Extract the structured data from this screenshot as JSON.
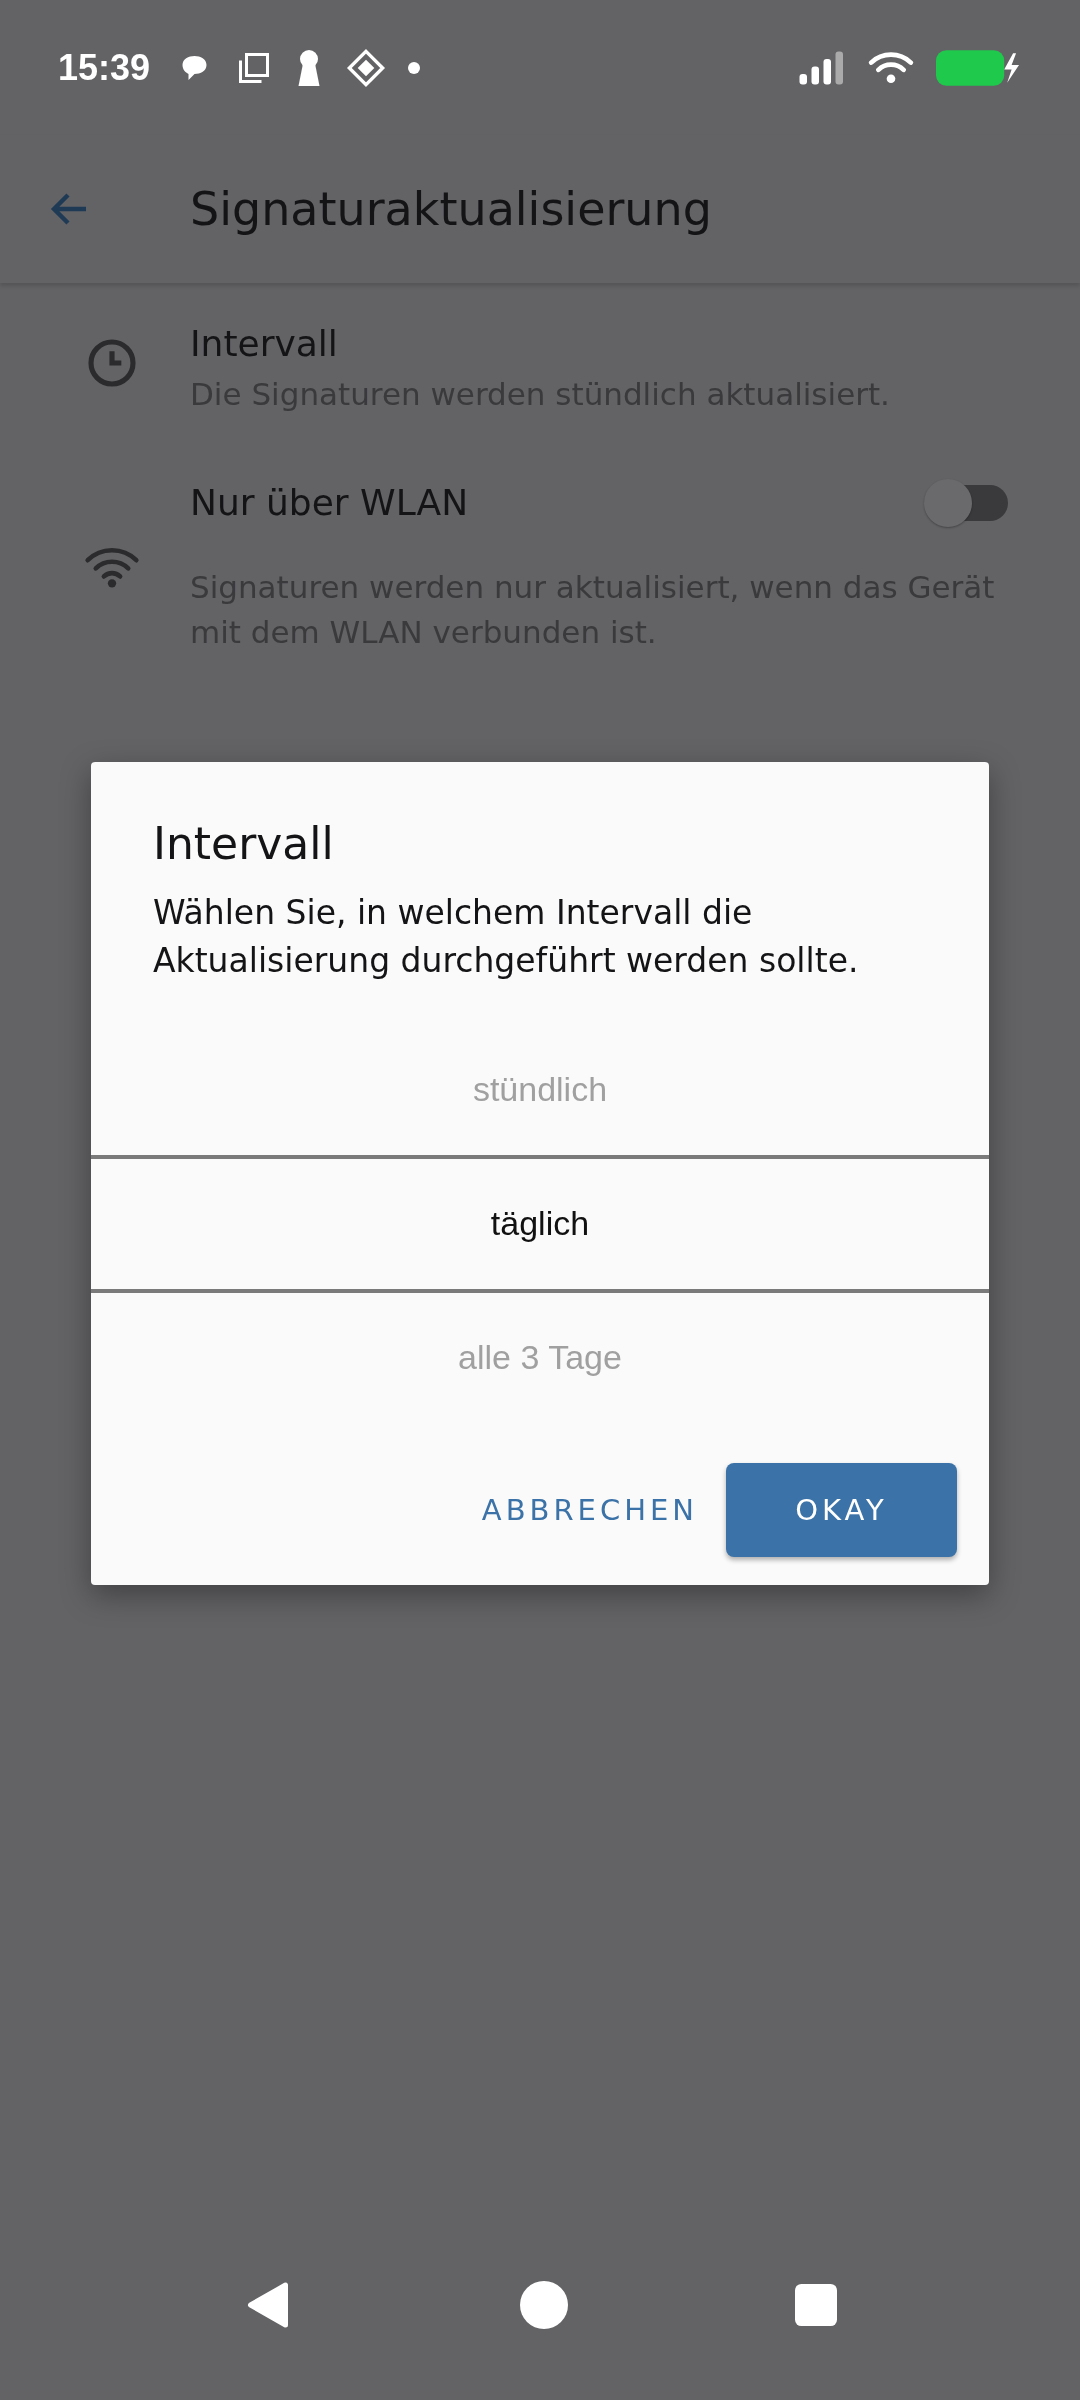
{
  "status_bar": {
    "time": "15:39"
  },
  "app_bar": {
    "title": "Signaturaktualisierung"
  },
  "settings": [
    {
      "kind": "text",
      "title": "Intervall",
      "summary": "Die Signaturen werden stündlich aktualisiert."
    },
    {
      "kind": "switch",
      "title": "Nur über WLAN",
      "summary": "Signaturen werden nur aktualisiert, wenn das Gerät mit dem WLAN verbunden ist.",
      "on": false
    }
  ],
  "dialog": {
    "title": "Intervall",
    "message": "Wählen Sie, in welchem Intervall die Aktualisierung durchgeführt werden sollte.",
    "options": [
      {
        "label": "stündlich",
        "selected": false
      },
      {
        "label": "täglich",
        "selected": true
      },
      {
        "label": "alle 3 Tage",
        "selected": false
      }
    ],
    "buttons": [
      {
        "kind": "text",
        "label": "ABBRECHEN"
      },
      {
        "kind": "filled",
        "label": "OKAY"
      }
    ]
  }
}
